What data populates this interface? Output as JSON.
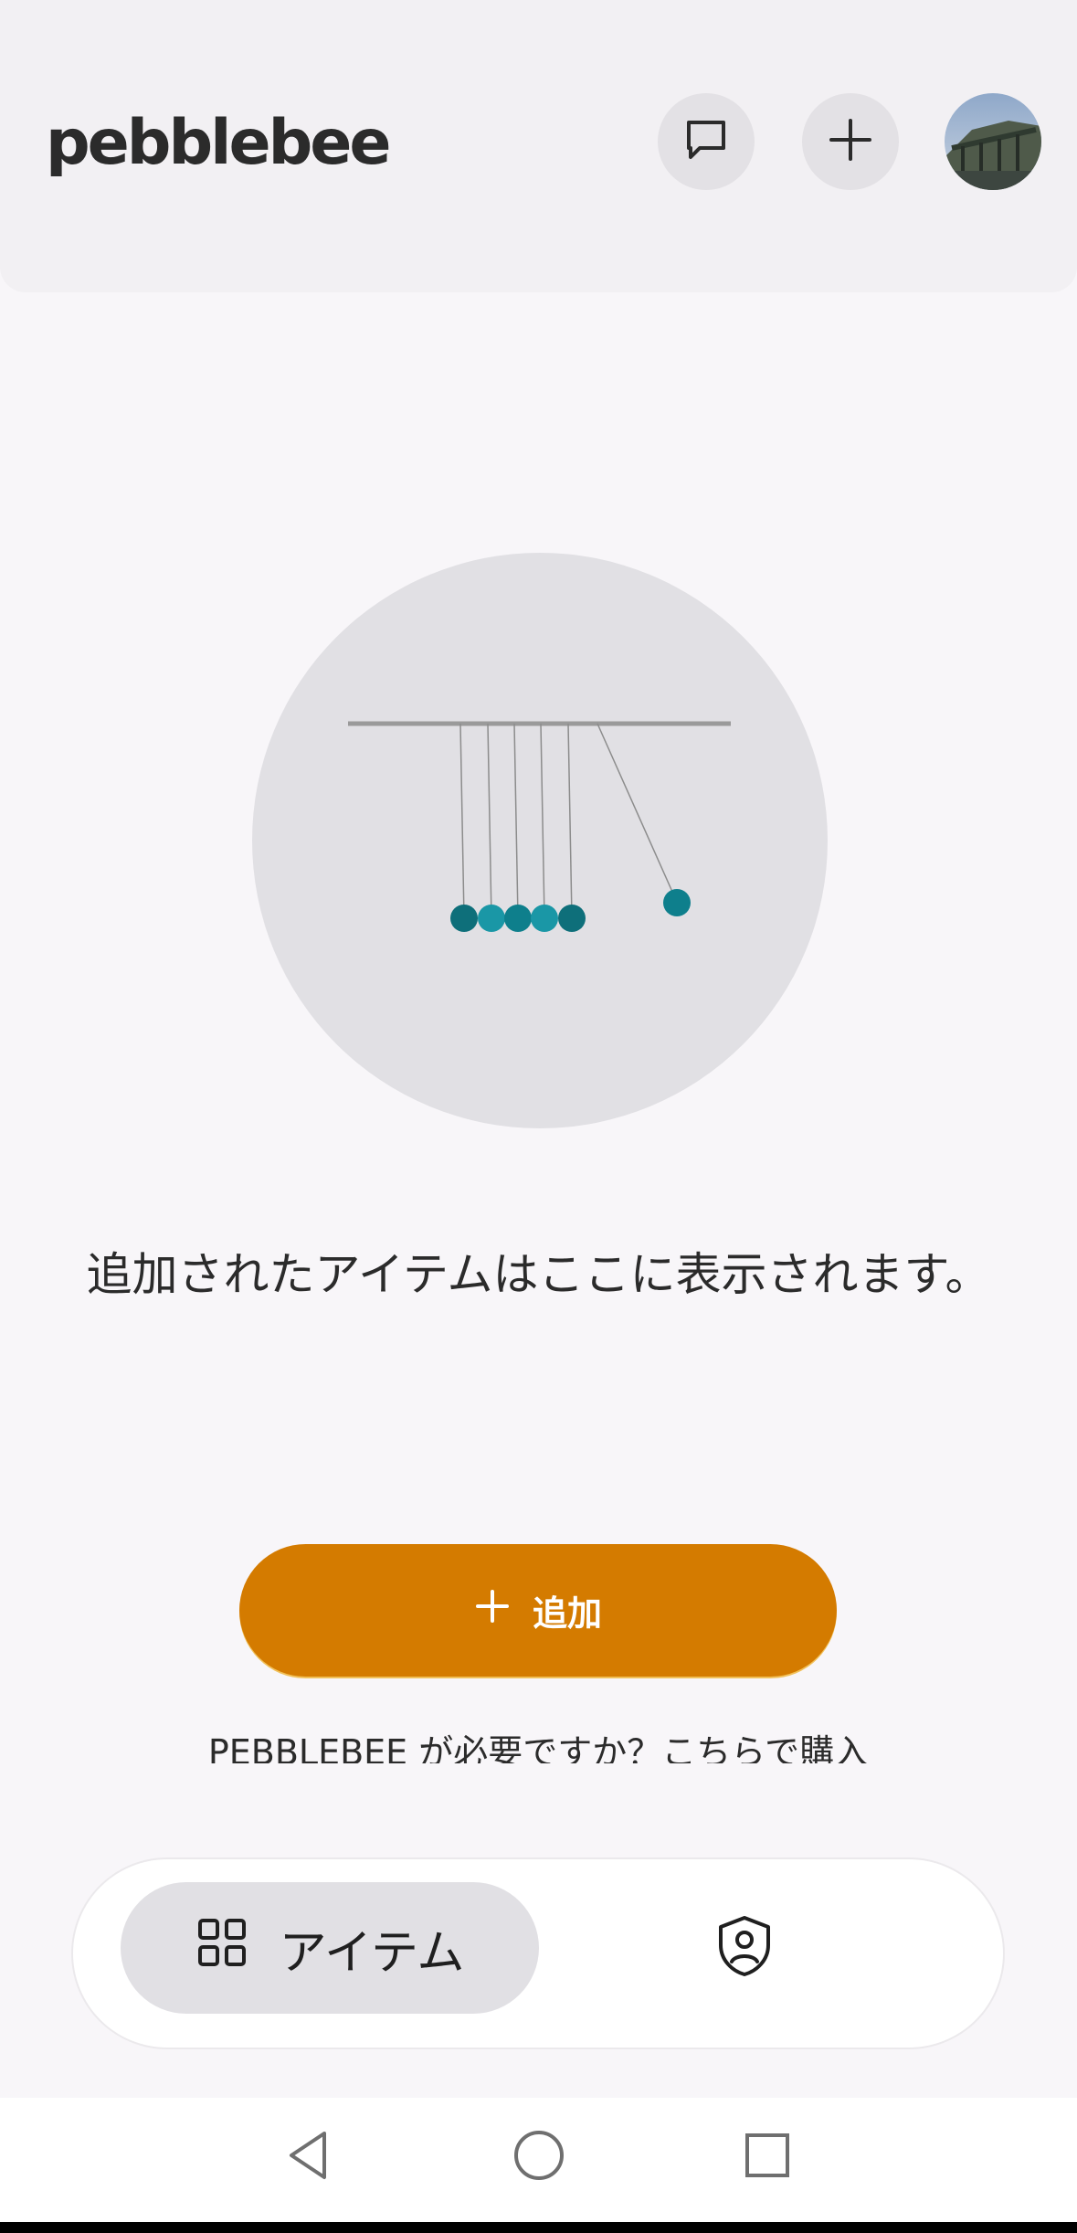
{
  "app": {
    "logo_text": "pebblebee"
  },
  "header": {
    "chat_button_icon": "chat-bubble-icon",
    "add_button_icon": "plus-icon",
    "avatar_icon": "user-avatar"
  },
  "empty_state": {
    "illustration": "newtons-cradle-illustration",
    "message": "追加されたアイテムはここに表示されます。"
  },
  "actions": {
    "add_label": "追加",
    "purchase_text": "PEBBLEBEE が必要ですか？こちらで購入"
  },
  "bottom_nav": {
    "items_label": "アイテム",
    "items_icon": "grid-icon",
    "security_icon": "shield-user-icon"
  },
  "system_nav": {
    "back": "back-icon",
    "home": "home-icon",
    "recents": "recents-icon"
  },
  "colors": {
    "accent": "#d47b00",
    "cradle_ball": "#0e7f8c"
  }
}
